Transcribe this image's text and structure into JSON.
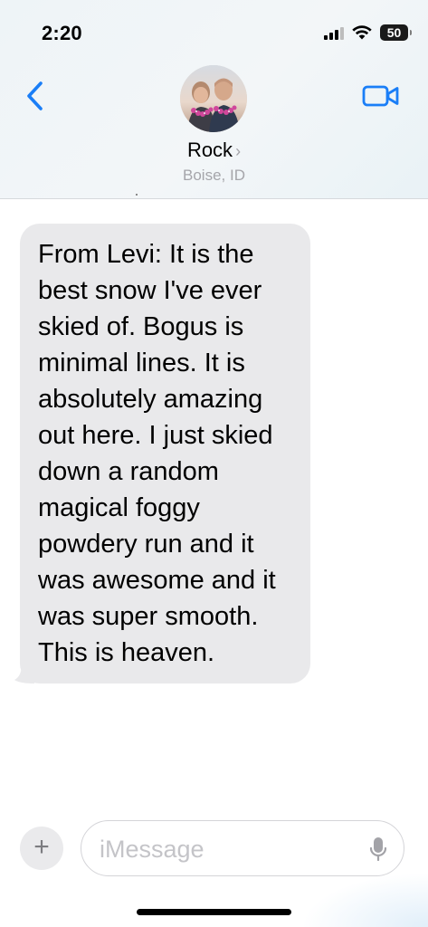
{
  "status_bar": {
    "time": "2:20",
    "battery_level": "50"
  },
  "header": {
    "contact_name": "Rock",
    "contact_location": "Boise, ID"
  },
  "messages": [
    {
      "direction": "incoming",
      "text": "From Levi: It is the best snow I've ever skied of. Bogus is minimal lines. It is absolutely amazing out here. I just skied down a random magical foggy powdery run and it was awesome and it was super smooth. This is heaven."
    }
  ],
  "composer": {
    "placeholder": "iMessage",
    "value": ""
  },
  "colors": {
    "accent": "#1a7ef7",
    "bubble_incoming": "#e9e9eb",
    "secondary_text": "#a5a5aa"
  }
}
